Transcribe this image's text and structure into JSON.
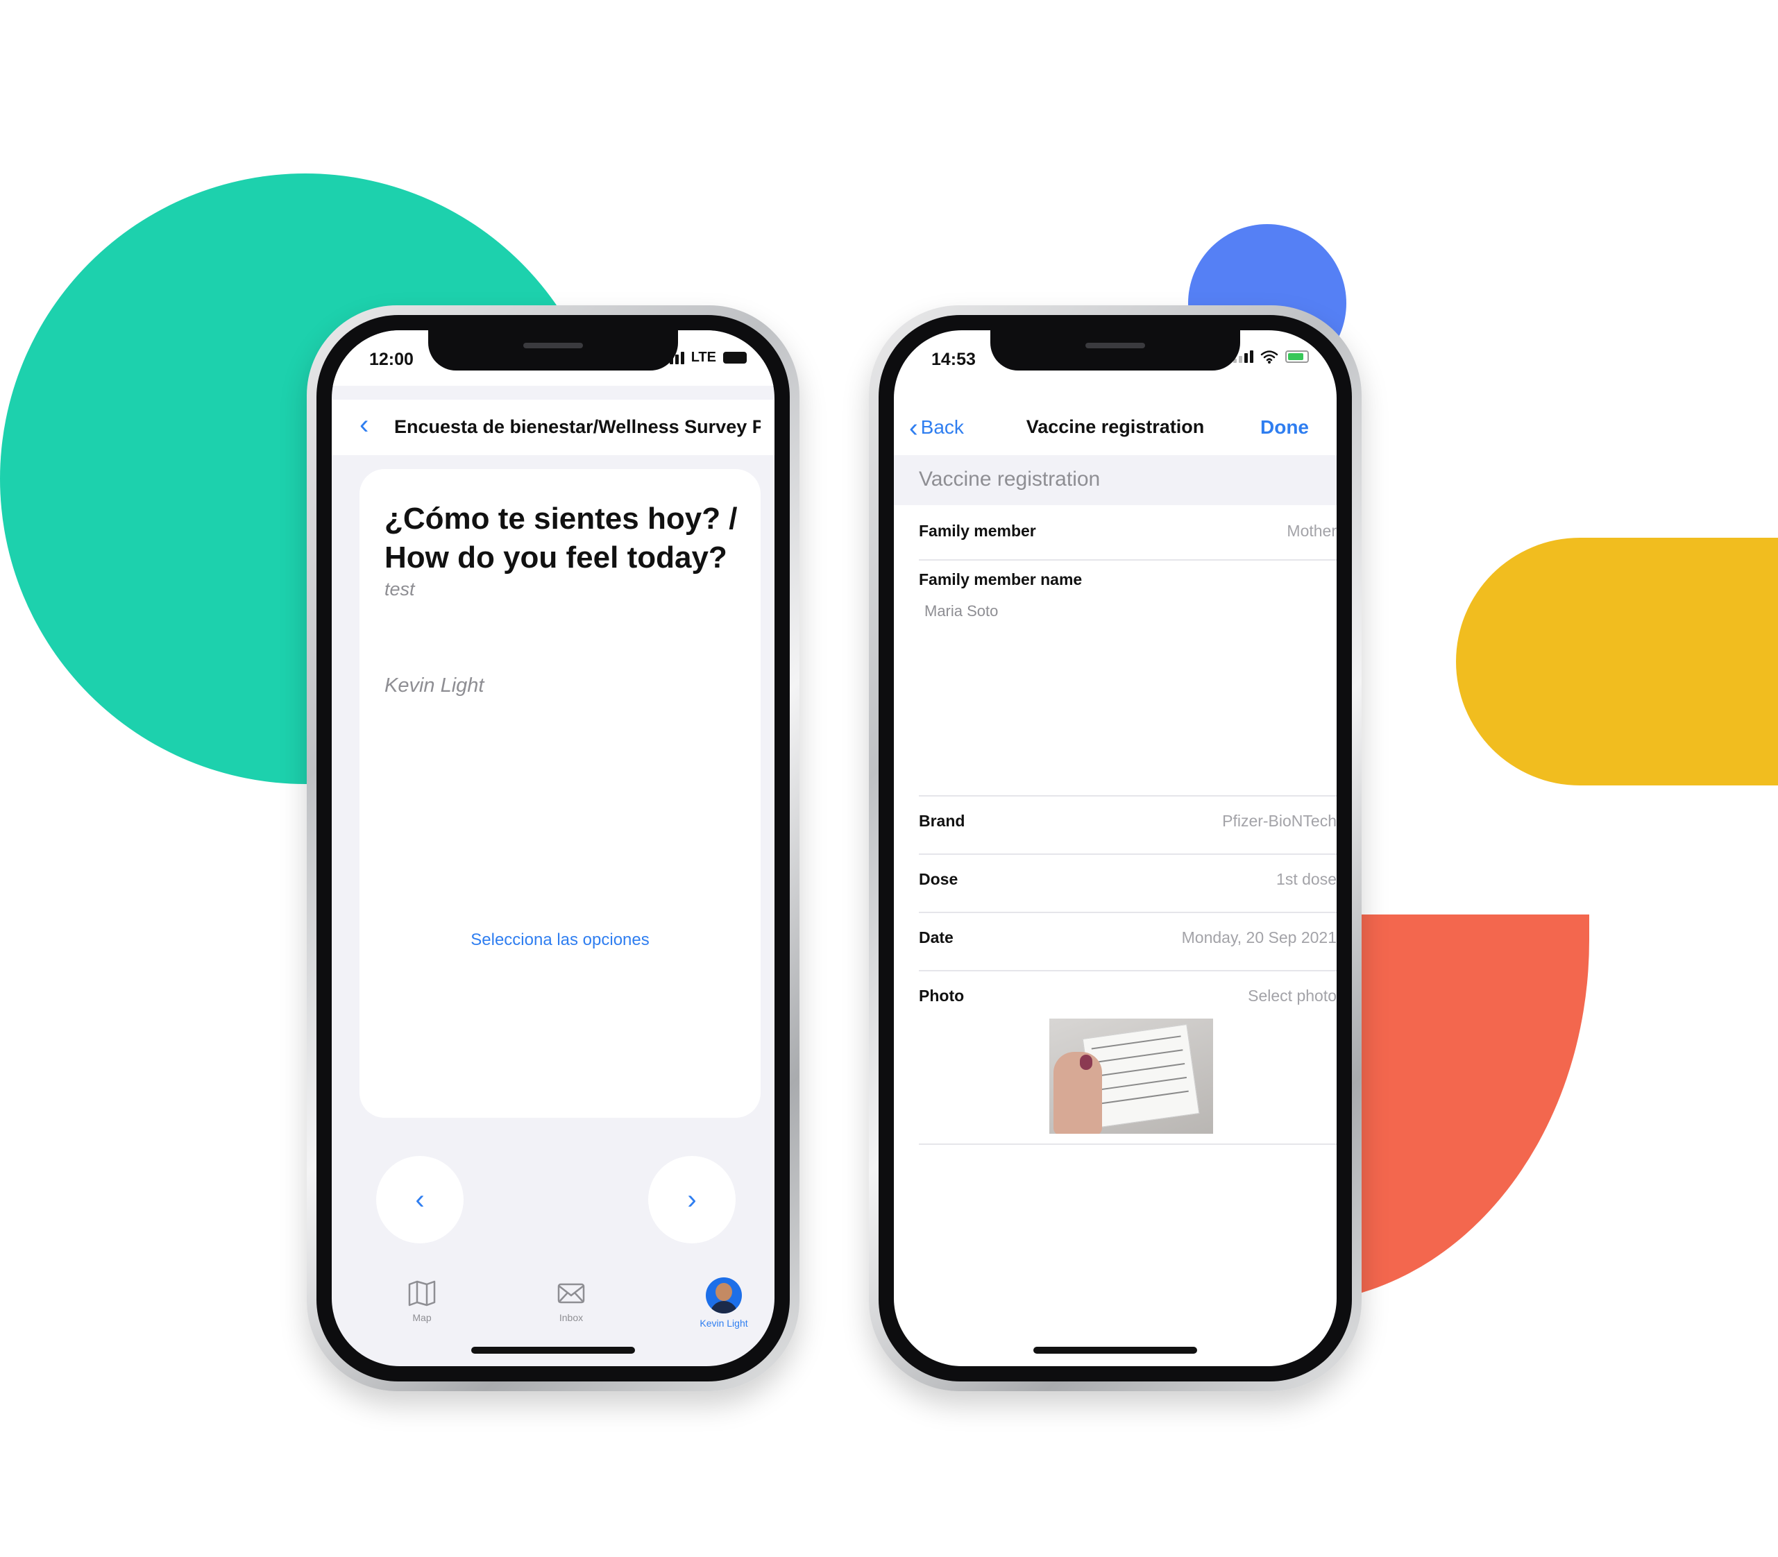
{
  "colors": {
    "green": "#1dd1ad",
    "blue": "#5580f5",
    "yellow": "#f1bd1f",
    "coral": "#f3674e",
    "ios_blue": "#2f7ef0"
  },
  "phone1": {
    "status_time": "12:00",
    "status_network": "LTE",
    "nav_title": "Encuesta de bienestar/Wellness Survey Pa...",
    "question_title": "¿Cómo te sientes hoy? / How do you feel today?",
    "question_subtitle": "test",
    "author": "Kevin Light",
    "select_options": "Selecciona las opciones",
    "prev_glyph": "‹",
    "next_glyph": "›",
    "tabs": [
      {
        "label": "Map",
        "icon": "map-icon"
      },
      {
        "label": "Inbox",
        "icon": "envelope-icon"
      },
      {
        "label": "Kevin Light",
        "icon": "avatar"
      }
    ]
  },
  "phone2": {
    "status_time": "14:53",
    "back_label": "Back",
    "nav_title": "Vaccine registration",
    "done_label": "Done",
    "section_header": "Vaccine registration",
    "rows": {
      "family_member": {
        "label": "Family member",
        "value": "Mother"
      },
      "family_member_name": {
        "label": "Family member name",
        "value": "Maria Soto"
      },
      "brand": {
        "label": "Brand",
        "value": "Pfizer-BioNTech"
      },
      "dose": {
        "label": "Dose",
        "value": "1st dose"
      },
      "date": {
        "label": "Date",
        "value": "Monday, 20 Sep 2021"
      },
      "photo": {
        "label": "Photo",
        "value": "Select photo"
      }
    }
  }
}
